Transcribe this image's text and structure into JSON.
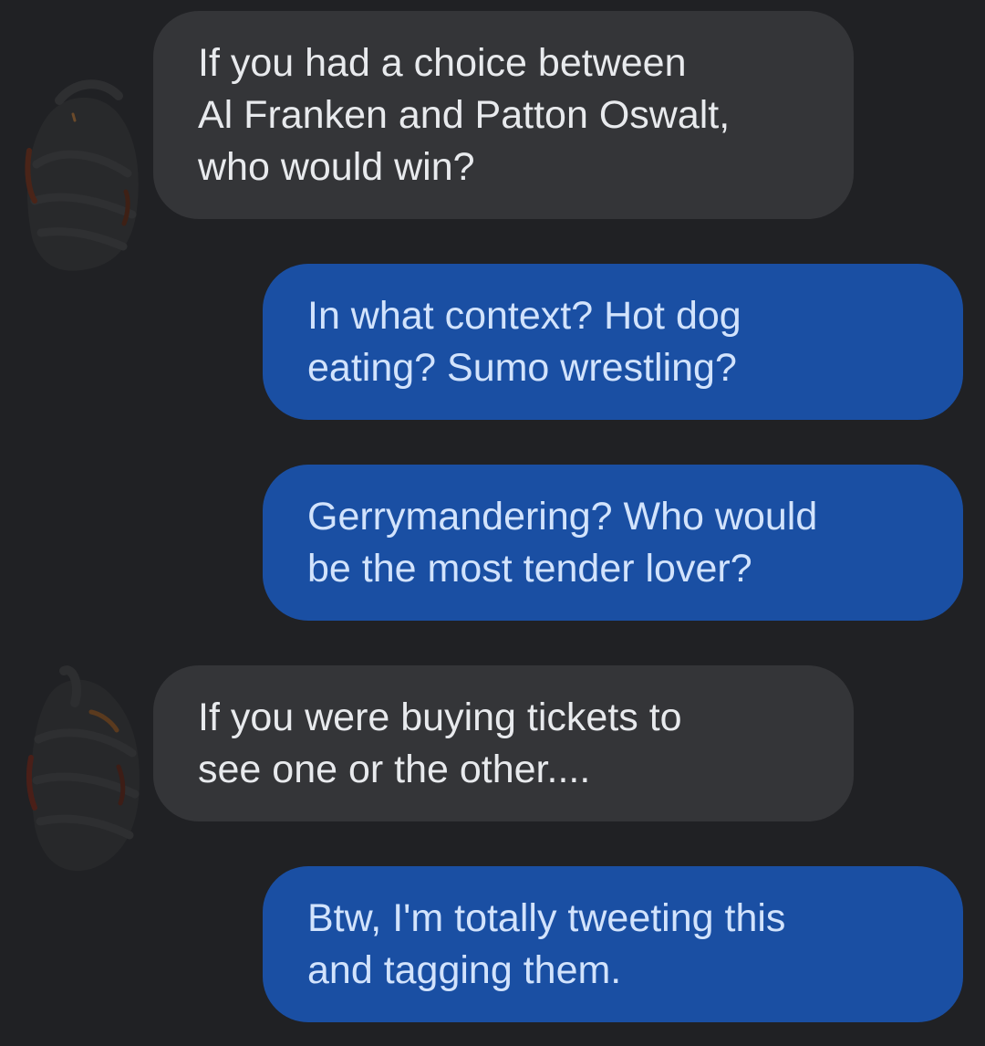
{
  "messages": [
    {
      "direction": "incoming",
      "lines": [
        "If you had a choice between",
        "Al Franken and Patton Oswalt,",
        "who would win?"
      ]
    },
    {
      "direction": "outgoing",
      "lines": [
        "In what context? Hot dog",
        "eating? Sumo wrestling?"
      ]
    },
    {
      "direction": "outgoing",
      "lines": [
        "Gerrymandering? Who would",
        "be the most tender lover?"
      ]
    },
    {
      "direction": "incoming",
      "lines": [
        "If you were buying tickets to",
        "see one or the other...."
      ]
    },
    {
      "direction": "outgoing",
      "lines": [
        "Btw, I'm totally tweeting this",
        "and tagging them."
      ]
    }
  ],
  "colors": {
    "background": "#202124",
    "incoming_bubble": "#343538",
    "incoming_text": "#e8eaed",
    "outgoing_bubble": "#1a4fa3",
    "outgoing_text": "#d2e3fc"
  }
}
